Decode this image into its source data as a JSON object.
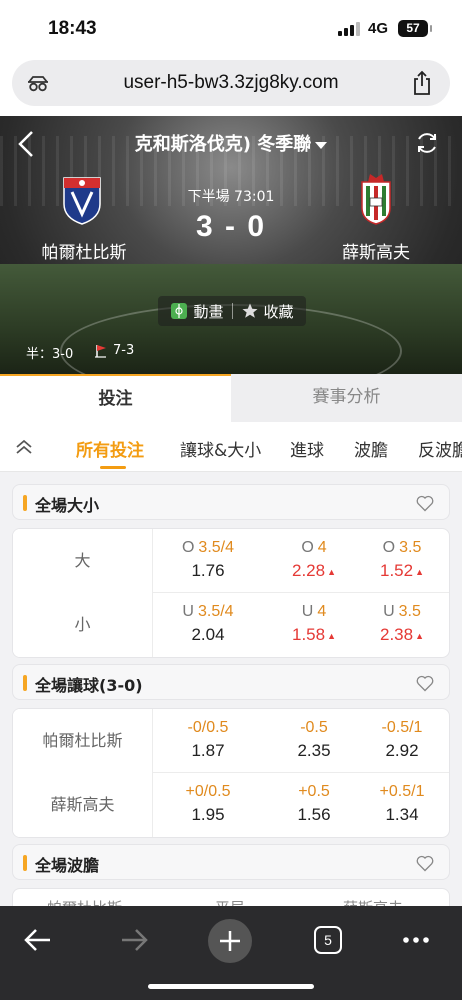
{
  "status_bar": {
    "time": "18:43",
    "network": "4G",
    "battery": "57"
  },
  "browser": {
    "url": "user-h5-bw3.3zjg8ky.com"
  },
  "match": {
    "league": "克和斯洛伐克)  冬季聯",
    "period": "下半場  73:01",
    "score": "3 - 0",
    "home_team": "帕爾杜比斯",
    "away_team": "薛斯高夫",
    "animation_label": "動畫",
    "favorite_label": "收藏",
    "half_score": "半：3-0",
    "corners": "7-3"
  },
  "main_tabs": [
    {
      "label": "投注",
      "active": true
    },
    {
      "label": "賽事分析",
      "active": false
    }
  ],
  "sub_tabs": [
    "所有投注",
    "讓球&大小",
    "進球",
    "波膽",
    "反波膽"
  ],
  "sections": {
    "over_under": {
      "title": "全場大小",
      "rows": [
        {
          "label": "大",
          "cells": [
            {
              "prefix": "O",
              "line": "3.5/4",
              "odds": "1.76",
              "up": false
            },
            {
              "prefix": "O",
              "line": "4",
              "odds": "2.28",
              "up": true
            },
            {
              "prefix": "O",
              "line": "3.5",
              "odds": "1.52",
              "up": true
            }
          ]
        },
        {
          "label": "小",
          "cells": [
            {
              "prefix": "U",
              "line": "3.5/4",
              "odds": "2.04",
              "up": false
            },
            {
              "prefix": "U",
              "line": "4",
              "odds": "1.58",
              "up": true
            },
            {
              "prefix": "U",
              "line": "3.5",
              "odds": "2.38",
              "up": true
            }
          ]
        }
      ]
    },
    "handicap": {
      "title": "全場讓球(3-0)",
      "rows": [
        {
          "label": "帕爾杜比斯",
          "cells": [
            {
              "prefix": "",
              "line": "-0/0.5",
              "odds": "1.87",
              "up": false
            },
            {
              "prefix": "",
              "line": "-0.5",
              "odds": "2.35",
              "up": false
            },
            {
              "prefix": "",
              "line": "-0.5/1",
              "odds": "2.92",
              "up": false
            }
          ]
        },
        {
          "label": "薛斯高夫",
          "cells": [
            {
              "prefix": "",
              "line": "+0/0.5",
              "odds": "1.95",
              "up": false
            },
            {
              "prefix": "",
              "line": "+0.5",
              "odds": "1.56",
              "up": false
            },
            {
              "prefix": "",
              "line": "+0.5/1",
              "odds": "1.34",
              "up": false
            }
          ]
        }
      ]
    },
    "correct_score": {
      "title": "全場波膽",
      "columns": [
        "帕爾杜比斯",
        "平局",
        "薛斯高夫"
      ]
    }
  },
  "toolbar": {
    "tab_count": "5"
  },
  "colors": {
    "accent": "#f6a623",
    "odds_up": "#e53935",
    "line": "#e08a1e"
  }
}
